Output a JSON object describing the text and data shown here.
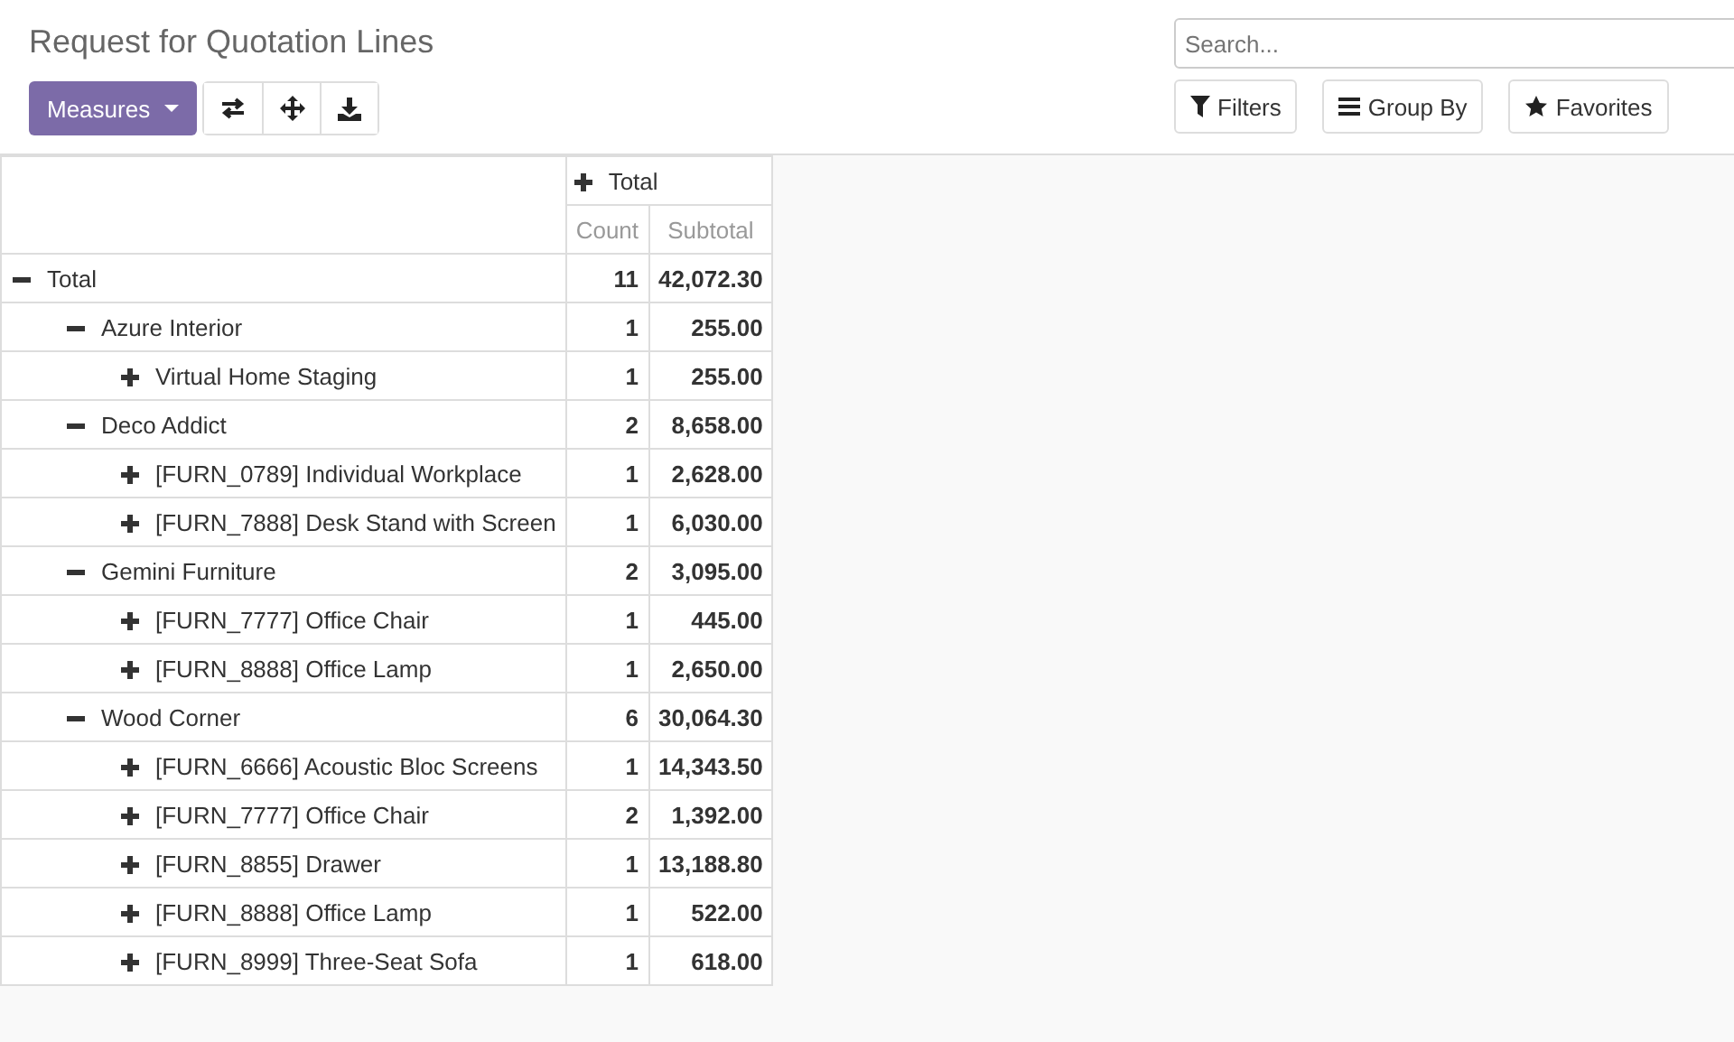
{
  "title": "Request for Quotation Lines",
  "toolbar": {
    "measures": "Measures"
  },
  "search": {
    "placeholder": "Search..."
  },
  "search_buttons": [
    {
      "kind": "filter",
      "label": "Filters"
    },
    {
      "kind": "groupby",
      "label": "Group By"
    },
    {
      "kind": "favorite",
      "label": "Favorites"
    }
  ],
  "pivot": {
    "column_header": {
      "label": "Total",
      "expanded": false
    },
    "measures": [
      "Count",
      "Subtotal"
    ],
    "rows": [
      {
        "label": "Total",
        "expanded": true,
        "count": "11",
        "subtotal": "42,072.30",
        "children": [
          {
            "label": "Azure Interior",
            "expanded": true,
            "count": "1",
            "subtotal": "255.00",
            "children": [
              {
                "label": "Virtual Home Staging",
                "expanded": false,
                "count": "1",
                "subtotal": "255.00"
              }
            ]
          },
          {
            "label": "Deco Addict",
            "expanded": true,
            "count": "2",
            "subtotal": "8,658.00",
            "children": [
              {
                "label": "[FURN_0789] Individual Workplace",
                "expanded": false,
                "count": "1",
                "subtotal": "2,628.00"
              },
              {
                "label": "[FURN_7888] Desk Stand with Screen",
                "expanded": false,
                "count": "1",
                "subtotal": "6,030.00"
              }
            ]
          },
          {
            "label": "Gemini Furniture",
            "expanded": true,
            "count": "2",
            "subtotal": "3,095.00",
            "children": [
              {
                "label": "[FURN_7777] Office Chair",
                "expanded": false,
                "count": "1",
                "subtotal": "445.00"
              },
              {
                "label": "[FURN_8888] Office Lamp",
                "expanded": false,
                "count": "1",
                "subtotal": "2,650.00"
              }
            ]
          },
          {
            "label": "Wood Corner",
            "expanded": true,
            "count": "6",
            "subtotal": "30,064.30",
            "children": [
              {
                "label": "[FURN_6666] Acoustic Bloc Screens",
                "expanded": false,
                "count": "1",
                "subtotal": "14,343.50"
              },
              {
                "label": "[FURN_7777] Office Chair",
                "expanded": false,
                "count": "2",
                "subtotal": "1,392.00"
              },
              {
                "label": "[FURN_8855] Drawer",
                "expanded": false,
                "count": "1",
                "subtotal": "13,188.80"
              },
              {
                "label": "[FURN_8888] Office Lamp",
                "expanded": false,
                "count": "1",
                "subtotal": "522.00"
              },
              {
                "label": "[FURN_8999] Three-Seat Sofa",
                "expanded": false,
                "count": "1",
                "subtotal": "618.00"
              }
            ]
          }
        ]
      }
    ]
  }
}
